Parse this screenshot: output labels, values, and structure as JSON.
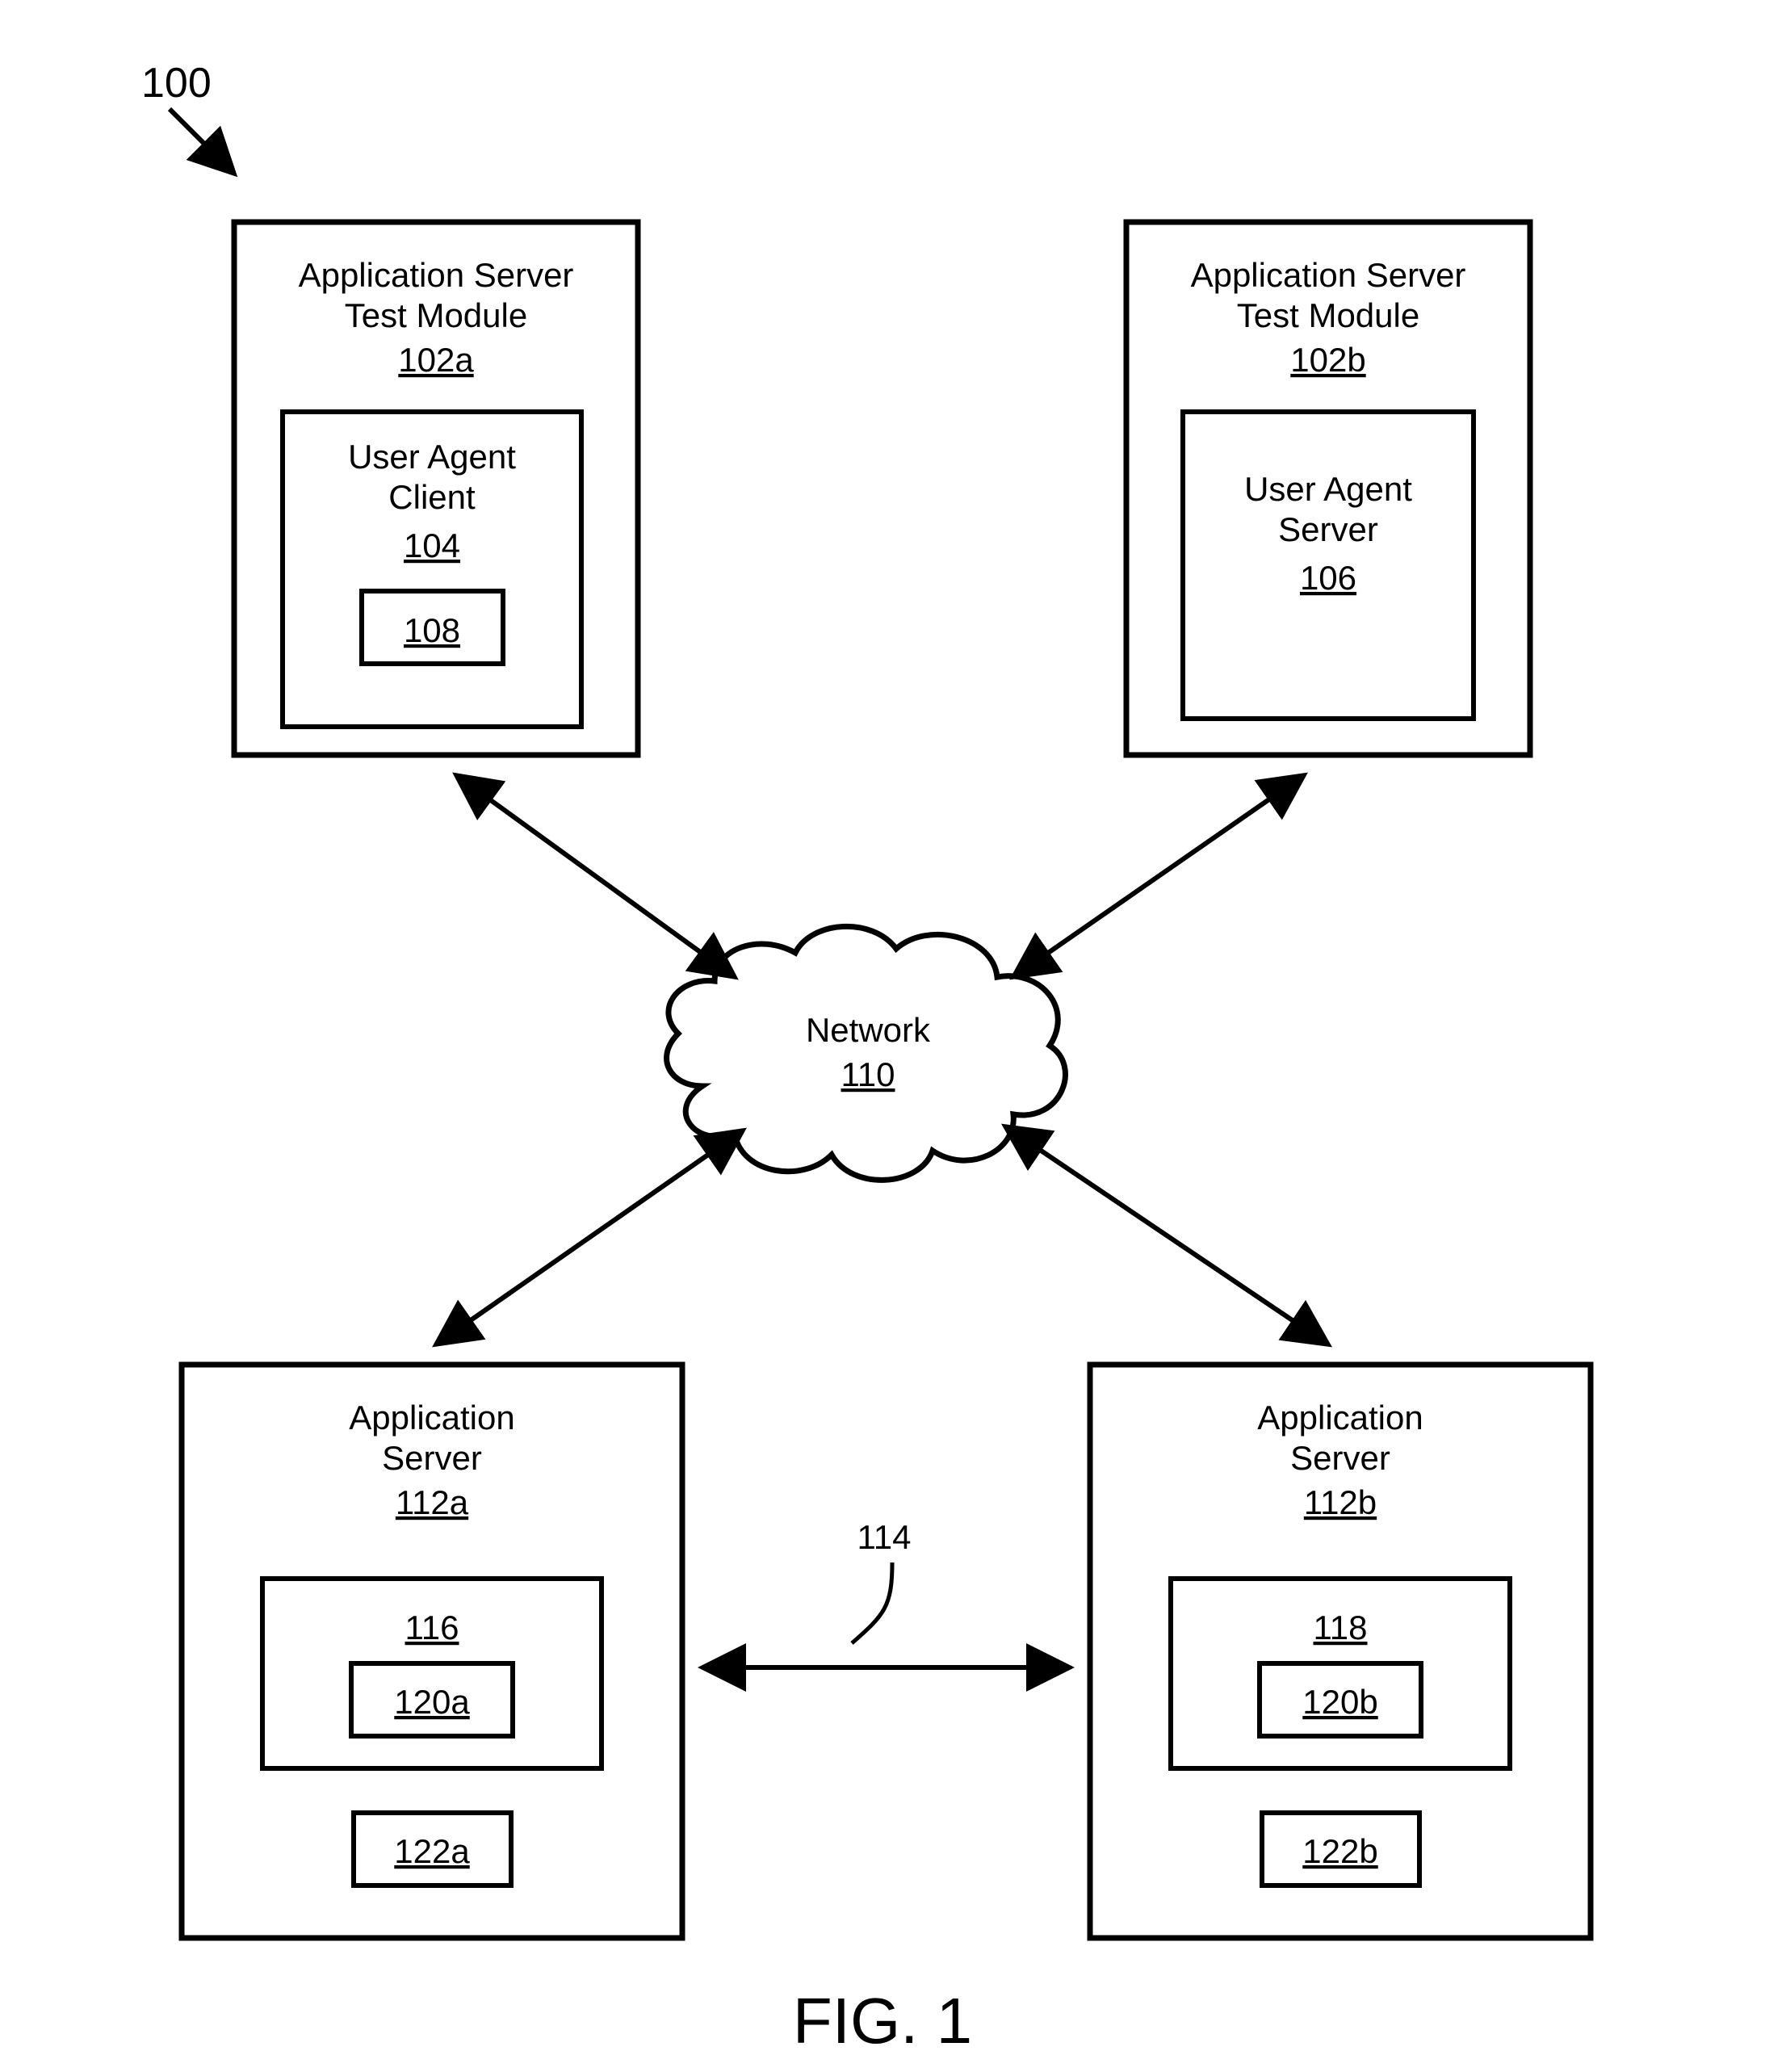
{
  "figure": {
    "system_ref": "100",
    "caption": "FIG. 1"
  },
  "top_left": {
    "title_l1": "Application Server",
    "title_l2": "Test Module",
    "ref": "102a",
    "inner": {
      "title_l1": "User Agent",
      "title_l2": "Client",
      "ref": "104",
      "sub_ref": "108"
    }
  },
  "top_right": {
    "title_l1": "Application Server",
    "title_l2": "Test Module",
    "ref": "102b",
    "inner": {
      "title_l1": "User Agent",
      "title_l2": "Server",
      "ref": "106"
    }
  },
  "network": {
    "label": "Network",
    "ref": "110"
  },
  "bottom_left": {
    "title_l1": "Application",
    "title_l2": "Server",
    "ref": "112a",
    "inner_top_ref": "116",
    "inner_sub_ref": "120a",
    "lower_ref": "122a"
  },
  "bottom_right": {
    "title_l1": "Application",
    "title_l2": "Server",
    "ref": "112b",
    "inner_top_ref": "118",
    "inner_sub_ref": "120b",
    "lower_ref": "122b"
  },
  "link_ref": "114"
}
